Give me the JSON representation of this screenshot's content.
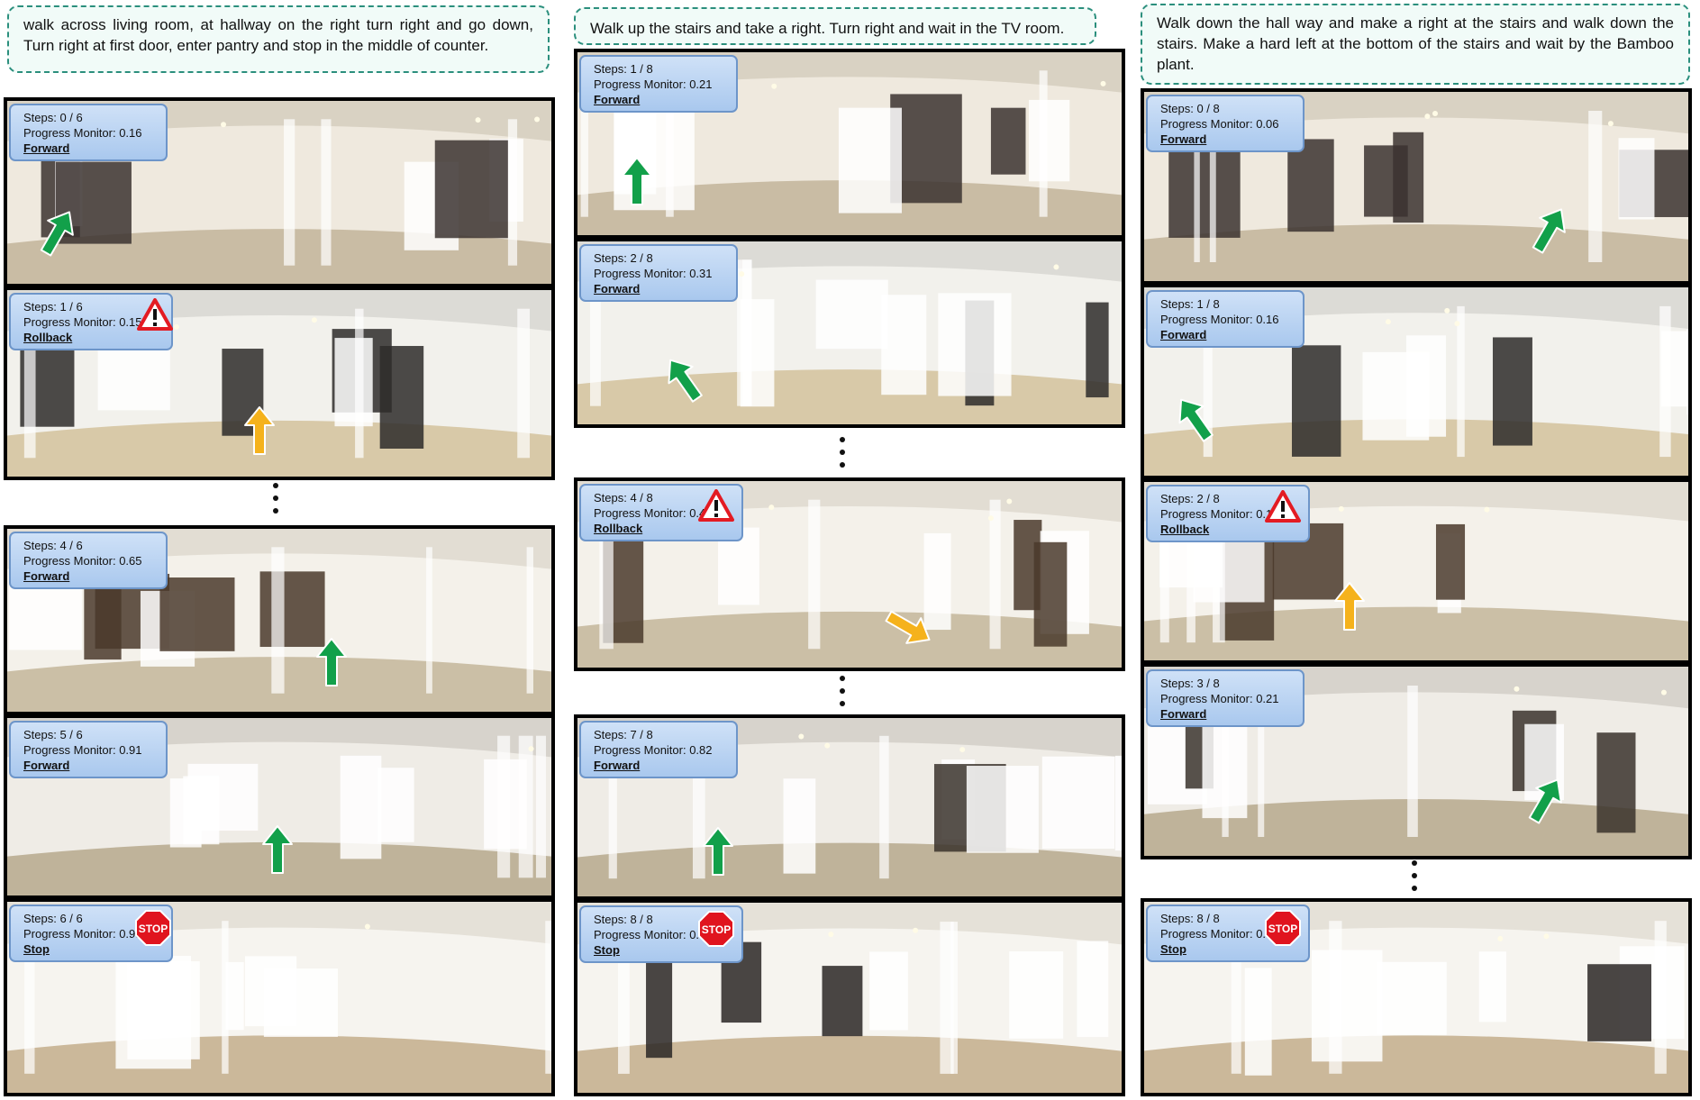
{
  "columns": [
    {
      "instruction": "walk across living room, at hallway on the right turn right and go down, Turn right at first door, enter pantry and stop in the middle of counter.",
      "panels": [
        {
          "steps": "Steps: 0 / 6",
          "progress": "Progress Monitor: 0.16",
          "action": "Forward",
          "icon": "none",
          "arrow_color": "#12a04a",
          "arrow_direction": "up-right"
        },
        {
          "steps": "Steps: 1 / 6",
          "progress": "Progress Monitor: 0.15",
          "action": "Rollback",
          "icon": "warning-icon",
          "arrow_color": "#f5b21c",
          "arrow_direction": "up"
        },
        {
          "steps": "Steps: 4 / 6",
          "progress": "Progress Monitor: 0.65",
          "action": "Forward",
          "icon": "none",
          "arrow_color": "#12a04a",
          "arrow_direction": "up"
        },
        {
          "steps": "Steps: 5 / 6",
          "progress": "Progress Monitor: 0.91",
          "action": "Forward",
          "icon": "none",
          "arrow_color": "#12a04a",
          "arrow_direction": "up"
        },
        {
          "steps": "Steps: 6 / 6",
          "progress": "Progress Monitor: 0.99",
          "action": "Stop",
          "icon": "stop-icon",
          "arrow_color": "",
          "arrow_direction": "none"
        }
      ]
    },
    {
      "instruction": "Walk up the stairs and take a right. Turn right and wait in the TV room.",
      "panels": [
        {
          "steps": "Steps: 1 / 8",
          "progress": "Progress Monitor: 0.21",
          "action": "Forward",
          "icon": "none",
          "arrow_color": "#12a04a",
          "arrow_direction": "up"
        },
        {
          "steps": "Steps: 2 / 8",
          "progress": "Progress Monitor: 0.31",
          "action": "Forward",
          "icon": "none",
          "arrow_color": "#12a04a",
          "arrow_direction": "up-left"
        },
        {
          "steps": "Steps: 4 / 8",
          "progress": "Progress Monitor: 0.43",
          "action": "Rollback",
          "icon": "warning-icon",
          "arrow_color": "#f5b21c",
          "arrow_direction": "down-right"
        },
        {
          "steps": "Steps: 7 / 8",
          "progress": "Progress Monitor: 0.82",
          "action": "Forward",
          "icon": "none",
          "arrow_color": "#12a04a",
          "arrow_direction": "up"
        },
        {
          "steps": "Steps: 8 / 8",
          "progress": "Progress Monitor: 0.95",
          "action": "Stop",
          "icon": "stop-icon",
          "arrow_color": "",
          "arrow_direction": "none"
        }
      ]
    },
    {
      "instruction": "Walk down the hall way and make a right at the stairs and walk down the stairs.  Make a hard left at the bottom of the stairs and wait by the Bamboo plant.",
      "panels": [
        {
          "steps": "Steps: 0 / 8",
          "progress": "Progress Monitor: 0.06",
          "action": "Forward",
          "icon": "none",
          "arrow_color": "#12a04a",
          "arrow_direction": "up-right"
        },
        {
          "steps": "Steps: 1 / 8",
          "progress": "Progress Monitor: 0.16",
          "action": "Forward",
          "icon": "none",
          "arrow_color": "#12a04a",
          "arrow_direction": "up-left"
        },
        {
          "steps": "Steps: 2 / 8",
          "progress": "Progress Monitor: 0.19",
          "action": "Rollback",
          "icon": "warning-icon",
          "arrow_color": "#f5b21c",
          "arrow_direction": "up"
        },
        {
          "steps": "Steps: 3 / 8",
          "progress": "Progress Monitor: 0.21",
          "action": "Forward",
          "icon": "none",
          "arrow_color": "#12a04a",
          "arrow_direction": "up-right"
        },
        {
          "steps": "Steps: 8 / 8",
          "progress": "Progress Monitor: 0.99",
          "action": "Stop",
          "icon": "stop-icon",
          "arrow_color": "",
          "arrow_direction": "none"
        }
      ]
    }
  ],
  "stop_sign_text": "STOP"
}
